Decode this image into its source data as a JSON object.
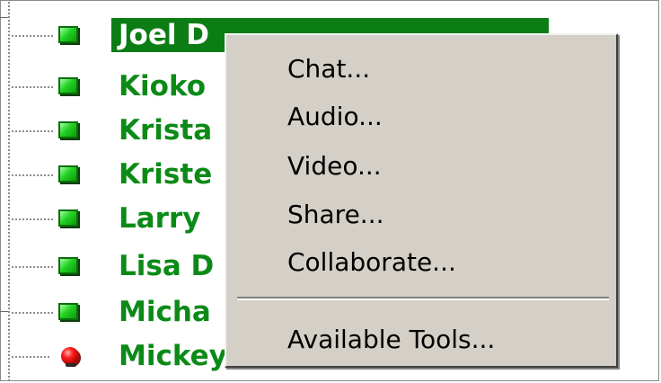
{
  "contacts": [
    {
      "name": "Joel D",
      "status": "online",
      "selected": true
    },
    {
      "name": "Kioko",
      "status": "online",
      "selected": false
    },
    {
      "name": "Krista",
      "status": "online",
      "selected": false
    },
    {
      "name": "Kriste",
      "status": "online",
      "selected": false
    },
    {
      "name": "Larry",
      "status": "online",
      "selected": false
    },
    {
      "name": "Lisa D",
      "status": "online",
      "selected": false
    },
    {
      "name": "Micha",
      "status": "online",
      "selected": false
    },
    {
      "name": "Mickey",
      "status": "offline",
      "selected": false
    }
  ],
  "context_menu": {
    "chat": "Chat...",
    "audio": "Audio...",
    "video": "Video...",
    "share": "Share...",
    "collaborate": "Collaborate...",
    "available_tools": "Available Tools..."
  },
  "colors": {
    "name_green": "#0b8a17",
    "selection_bg": "#0c7d14",
    "menu_bg": "#d4d0c8",
    "online": "#22d222",
    "offline": "#ff2020"
  },
  "icons": {
    "online": "online-status-icon",
    "offline": "offline-status-icon"
  }
}
